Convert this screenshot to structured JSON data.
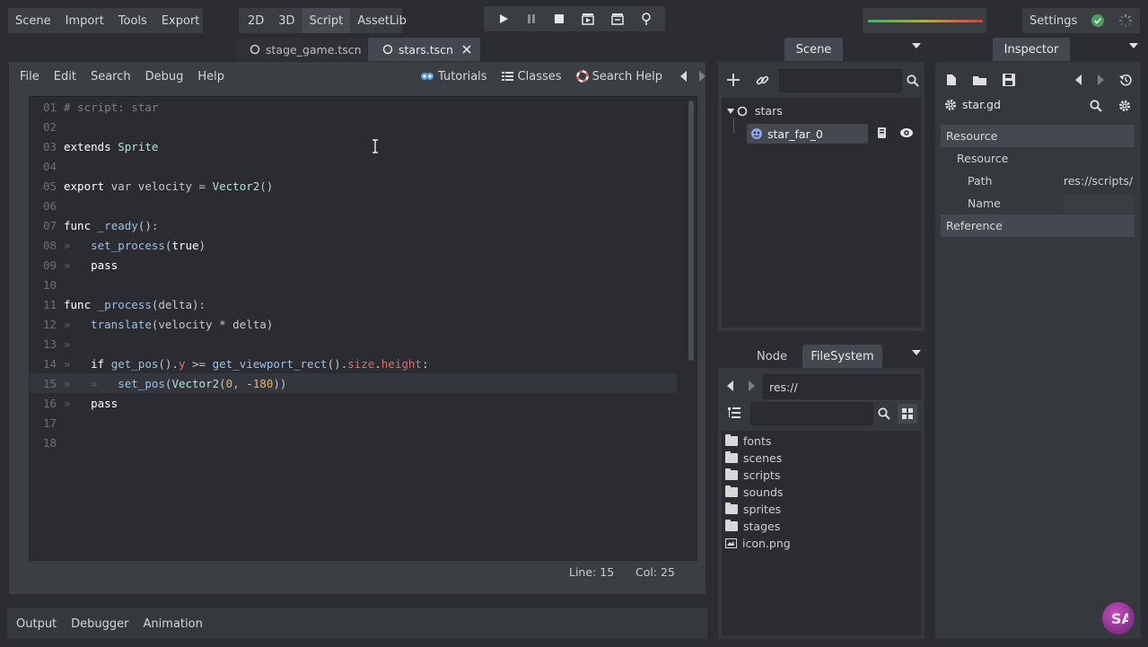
{
  "main_menu": [
    "Scene",
    "Import",
    "Tools",
    "Export"
  ],
  "workspaces": [
    {
      "label": "2D",
      "active": false
    },
    {
      "label": "3D",
      "active": false
    },
    {
      "label": "Script",
      "active": true
    },
    {
      "label": "AssetLib",
      "active": false
    }
  ],
  "playback": [
    "play-icon",
    "pause-icon",
    "stop-icon",
    "play-scene-icon",
    "play-custom-icon",
    "remote-debug-icon"
  ],
  "settings_label": "Settings",
  "scene_tabs": [
    {
      "label": "stage_game.tscn",
      "active": false
    },
    {
      "label": "stars.tscn",
      "active": true
    }
  ],
  "script_menu": [
    "File",
    "Edit",
    "Search",
    "Debug",
    "Help"
  ],
  "script_help": {
    "tutorials": "Tutorials",
    "classes": "Classes",
    "search_help": "Search Help"
  },
  "status": {
    "line": "Line: 15",
    "col": "Col: 25"
  },
  "bottom_tabs": [
    "Output",
    "Debugger",
    "Animation"
  ],
  "scene_dock": {
    "title": "Scene",
    "root": "stars",
    "child": "star_far_0"
  },
  "fs_dock": {
    "tabs": [
      "Node",
      "FileSystem"
    ],
    "path": "res://",
    "items": [
      {
        "name": "fonts",
        "type": "folder"
      },
      {
        "name": "scenes",
        "type": "folder"
      },
      {
        "name": "scripts",
        "type": "folder"
      },
      {
        "name": "sounds",
        "type": "folder"
      },
      {
        "name": "sprites",
        "type": "folder"
      },
      {
        "name": "stages",
        "type": "folder"
      },
      {
        "name": "icon.png",
        "type": "image"
      }
    ]
  },
  "inspector": {
    "title": "Inspector",
    "resource_name": "star.gd",
    "section_resource": "Resource",
    "subsection": "Resource",
    "path_label": "Path",
    "path_value": "res://scripts/",
    "name_label": "Name",
    "section_reference": "Reference"
  },
  "code_lines": [
    {
      "n": "01",
      "html": "<span class='cmt'># script: star</span>"
    },
    {
      "n": "02",
      "html": ""
    },
    {
      "n": "03",
      "html": "<span class='kw'>extends</span> <span class='cls'>Sprite</span>"
    },
    {
      "n": "04",
      "html": ""
    },
    {
      "n": "05",
      "html": "<span class='kw'>export</span> <span class='id'>var velocity</span> <span class='id'>=</span> <span class='cls'>Vector2</span><span class='id'>()</span>"
    },
    {
      "n": "06",
      "html": ""
    },
    {
      "n": "07",
      "html": "<span class='kw'>func</span> <span class='fn'>_ready</span><span class='id'>():</span>"
    },
    {
      "n": "08",
      "html": "<span class='tab-mark'>»   </span><span class='fn'>set_process</span><span class='id'>(</span><span class='kw'>true</span><span class='id'>)</span>"
    },
    {
      "n": "09",
      "html": "<span class='tab-mark'>»   </span><span class='kw'>pass</span>"
    },
    {
      "n": "10",
      "html": ""
    },
    {
      "n": "11",
      "html": "<span class='kw'>func</span> <span class='fn'>_process</span><span class='id'>(delta):</span>"
    },
    {
      "n": "12",
      "html": "<span class='tab-mark'>»   </span><span class='fn'>translate</span><span class='id'>(velocity * delta)</span>"
    },
    {
      "n": "13",
      "html": "<span class='tab-mark'>»</span>"
    },
    {
      "n": "14",
      "html": "<span class='tab-mark'>»   </span><span class='kw'>if</span> <span class='fn'>get_pos</span><span class='id'>().</span><span class='mem'>y</span> <span class='id'>&gt;=</span> <span class='fn'>get_viewport_rect</span><span class='id'>().</span><span class='mem'>size</span><span class='id'>.</span><span class='mem'>height</span><span class='id'>:</span>"
    },
    {
      "n": "15",
      "html": "<span class='tab-mark'>»   »   </span><span class='fn'>set_pos</span><span class='id'>(</span><span class='cls'>Vector2</span><span class='id'>(</span><span class='num'>0</span><span class='id'>, -</span><span class='num'>180</span><span class='id'>))</span>"
    },
    {
      "n": "16",
      "html": "<span class='tab-mark'>»   </span><span class='kw'>pass</span>"
    },
    {
      "n": "17",
      "html": ""
    },
    {
      "n": "18",
      "html": ""
    }
  ],
  "current_line": "15"
}
